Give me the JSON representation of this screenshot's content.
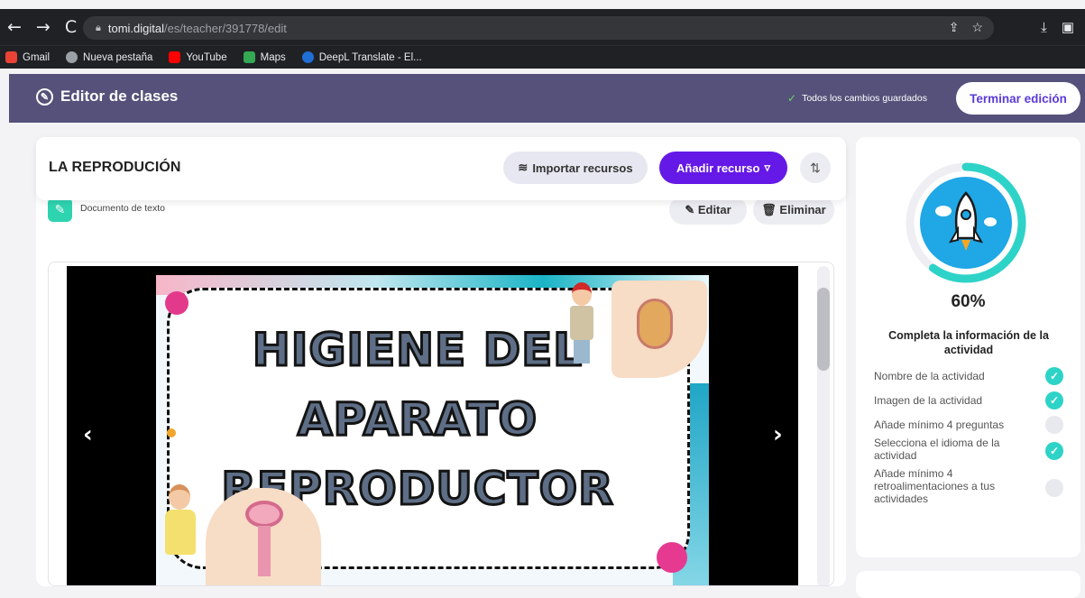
{
  "browser": {
    "url_host": "tomi.digital",
    "url_path": "/es/teacher/391778/edit",
    "bookmarks": [
      {
        "label": "Gmail",
        "color": "#ea4335"
      },
      {
        "label": "Nueva pestaña",
        "color": "#9aa0a6"
      },
      {
        "label": "YouTube",
        "color": "#ff0000"
      },
      {
        "label": "Maps",
        "color": "#34a853"
      },
      {
        "label": "DeepL Translate - El...",
        "color": "#0f2b46"
      }
    ]
  },
  "header": {
    "title": "Editor de clases",
    "saved_status": "Todos los cambios guardados",
    "finish_label": "Terminar edición"
  },
  "lesson": {
    "title": "LA REPRODUCIÓN",
    "import_label": "Importar recursos",
    "add_label": "Añadir recurso",
    "resource_type": "Documento de texto",
    "edit_label": "Editar",
    "delete_label": "Eliminar"
  },
  "slide": {
    "line1": "HIGIENE DEL",
    "line2": "APARATO",
    "line3": "REPRODUCTOR"
  },
  "progress": {
    "percent_label": "60%",
    "percent_value": 0.6,
    "accent": "#2ed3c8",
    "requirements_title": "Completa la información de la actividad",
    "items": [
      {
        "label": "Nombre de la actividad",
        "done": true
      },
      {
        "label": "Imagen de la actividad",
        "done": true
      },
      {
        "label": "Añade mínimo 4 preguntas",
        "done": false
      },
      {
        "label": "Selecciona el idioma de la actividad",
        "done": true
      },
      {
        "label": "Añade mínimo 4 retroalimentaciones a tus actividades",
        "done": false
      }
    ]
  }
}
